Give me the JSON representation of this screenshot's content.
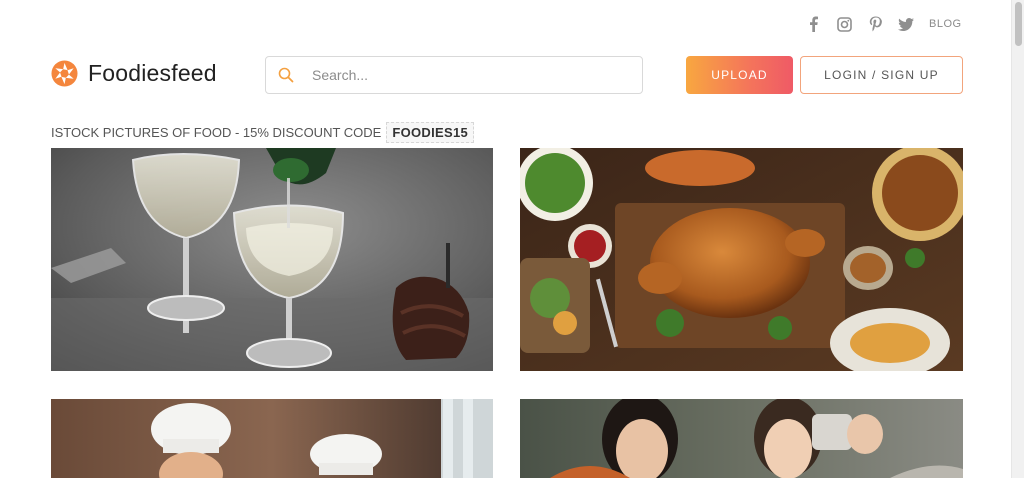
{
  "social": {
    "icons": [
      "facebook-icon",
      "instagram-icon",
      "pinterest-icon",
      "twitter-icon"
    ],
    "blog_label": "BLOG"
  },
  "header": {
    "logo_text": "Foodiesfeed",
    "search_placeholder": "Search...",
    "upload_label": "UPLOAD",
    "login_label": "LOGIN / SIGN UP"
  },
  "promo": {
    "text": "ISTOCK PICTURES OF FOOD - 15% DISCOUNT CODE",
    "code": "FOODIES15"
  },
  "colors": {
    "accent_orange": "#f8a740",
    "accent_red": "#ef5a66",
    "login_border": "#f2a47c"
  },
  "photos": [
    "champagne-glasses-photo",
    "roast-turkey-feast-photo",
    "kids-chef-hats-photo",
    "friends-selfie-photo"
  ]
}
